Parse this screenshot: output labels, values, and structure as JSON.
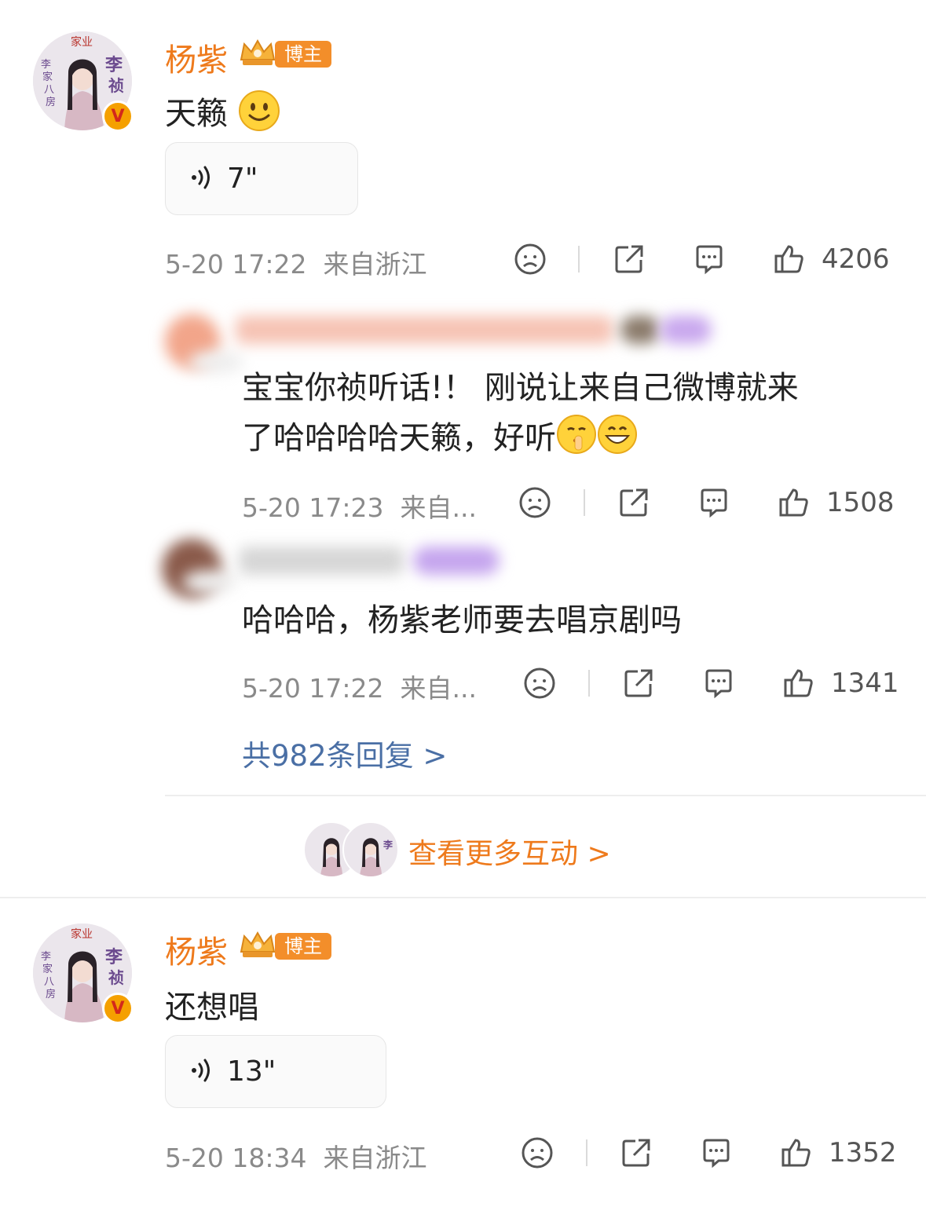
{
  "post1": {
    "author": "杨紫",
    "badge": "博主",
    "text": "天籁",
    "voice_duration": "7\"",
    "time": "5-20 17:22",
    "location": "来自浙江",
    "likes": "4206"
  },
  "replies": [
    {
      "text_line1": "宝宝你祯听话!！ 刚说让来自己微博就来",
      "text_line2": "了哈哈哈哈天籁，好听",
      "time": "5-20 17:23",
      "location": "来自...",
      "likes": "1508"
    },
    {
      "text_line1": "哈哈哈，杨紫老师要去唱京剧吗",
      "time": "5-20 17:22",
      "location": "来自...",
      "likes": "1341"
    }
  ],
  "reply_total_link": "共982条回复 >",
  "more_interactions_link": "查看更多互动 >",
  "post2": {
    "author": "杨紫",
    "badge": "博主",
    "text": "还想唱",
    "voice_duration": "13\"",
    "time": "5-20 18:34",
    "location": "来自浙江",
    "likes": "1352"
  },
  "avatar_text": {
    "top": "家业",
    "right": "李祯",
    "left": "李家八房"
  },
  "colors": {
    "name": "#ee7a1c",
    "tag": "#f38e2a",
    "link": "#4a6fa5",
    "meta": "#8a8a8a"
  }
}
